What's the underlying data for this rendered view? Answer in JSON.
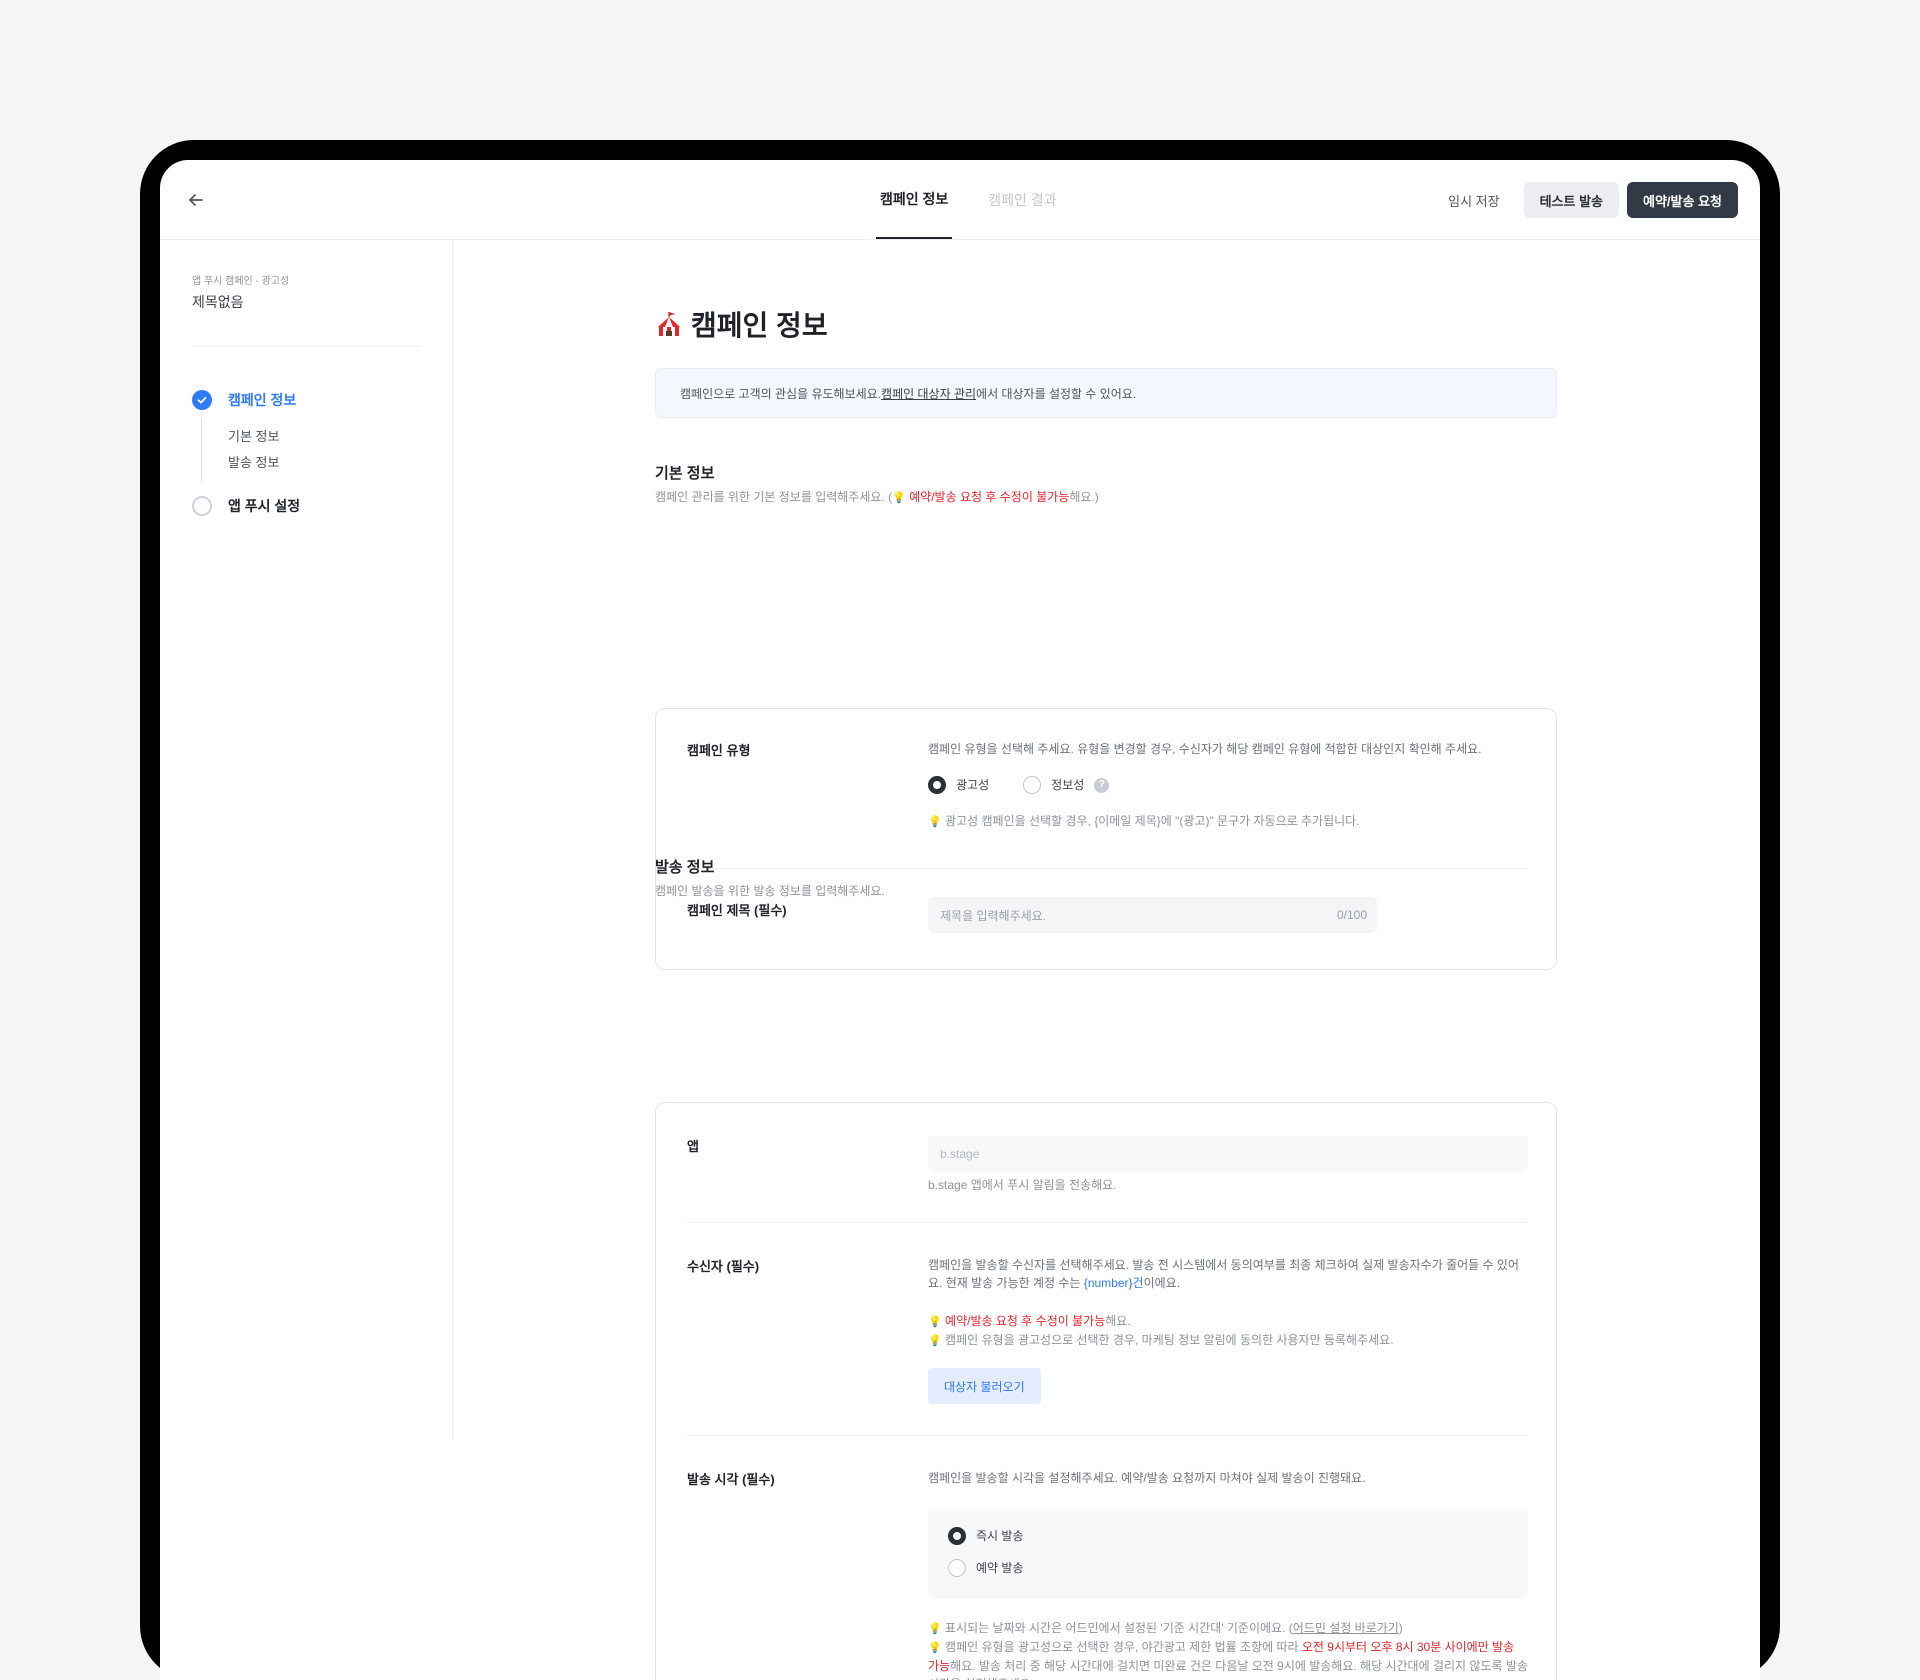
{
  "header": {
    "tabs": [
      {
        "label": "캠페인 정보",
        "active": true
      },
      {
        "label": "캠페인 결과",
        "active": false
      }
    ],
    "actions": {
      "save_draft": "임시 저장",
      "test_send": "테스트 발송",
      "schedule": "예약/발송 요청"
    }
  },
  "sidebar": {
    "breadcrumb": "앱 푸시 캠페인 - 광고성",
    "title": "제목없음",
    "steps": [
      {
        "label": "캠페인 정보",
        "status": "done",
        "substeps": [
          "기본 정보",
          "발송 정보"
        ]
      },
      {
        "label": "앱 푸시 설정",
        "status": "todo"
      }
    ]
  },
  "main": {
    "title": "캠페인 정보",
    "title_icon": "circus-tent-icon",
    "banner": {
      "prefix": "캠페인으로 고객의 관심을 유도해보세요. ",
      "link": "캠페인 대상자 관리",
      "suffix": "에서 대상자를 설정할 수 있어요."
    },
    "basic": {
      "title": "기본 정보",
      "desc_prefix": "캠페인 관리를 위한 기본 정보를 입력해주세요. (",
      "desc_red": " 예약/발송 요청 후 수정이 불가능",
      "desc_suffix": "해요.)",
      "type": {
        "label": "캠페인 유형",
        "desc": "캠페인 유형을 선택해 주세요. 유형을 변경할 경우, 수신자가 해당 캠페인 유형에 적합한 대상인지 확인해 주세요.",
        "options": [
          {
            "label": "광고성",
            "checked": true
          },
          {
            "label": "정보성",
            "checked": false
          }
        ],
        "hint": "광고성 캠페인을 선택할 경우, {이메일 제목}에 \"(광고)\" 문구가 자동으로 추가됩니다."
      },
      "campaign_title": {
        "label": "캠페인 제목 (필수)",
        "placeholder": "제목을 입력해주세요.",
        "counter": "0/100"
      }
    },
    "send": {
      "title": "발송 정보",
      "desc": "캠페인 발송을 위한 발송 정보를 입력해주세요.",
      "app": {
        "label": "앱",
        "value": "b.stage",
        "hint": "b.stage 앱에서 푸시 알림을 전송해요."
      },
      "recipients": {
        "label": "수신자 (필수)",
        "desc_prefix": "캠페인을 발송할 수신자를 선택해주세요. 발송 전 시스템에서 동의여부를 최종 체크하여 실제 발송자수가 줄어들 수 있어요. 현재 발송 가능한 계정 수는 ",
        "desc_blue": "{number}건",
        "desc_suffix": "이에요.",
        "hint1_red": " 예약/발송 요청 후 수정이 불가능",
        "hint1_suffix": "해요.",
        "hint2": " 캠페인 유형을 광고성으로 선택한 경우, 마케팅 정보 알림에 동의한 사용자만 등록해주세요.",
        "button": "대상자 불러오기"
      },
      "send_time": {
        "label": "발송 시각 (필수)",
        "desc": "캠페인을 발송할 시각을 설정해주세요. 예약/발송 요청까지 마쳐야 실제 발송이 진행돼요.",
        "options": [
          {
            "label": "즉시 발송",
            "checked": true
          },
          {
            "label": "예약 발송",
            "checked": false
          }
        ],
        "hint1_prefix": " 표시되는 날짜와 시간은 어드민에서 설정된 '기준 시간대' 기준이에요. (",
        "hint1_link": "어드민 설정 바로가기",
        "hint1_suffix": ")",
        "hint2_prefix": " 캠페인 유형을 광고성으로 선택한 경우, 야간광고 제한 법률 조항에 따라 ",
        "hint2_red": "오전 9시부터 오후 8시 30분 사이에만 발송 가능",
        "hint2_suffix": "해요. 발송 처리 중 해당 시간대에 걸치면 미완료 건은 다음날 오전 9시에 발송해요. 해당 시간대에 걸리지 않도록 발송 시각을 설정해주세요."
      }
    }
  },
  "colors": {
    "accent": "#2f7bf5",
    "dark_button": "#323a45",
    "warning": "#e5242b"
  }
}
